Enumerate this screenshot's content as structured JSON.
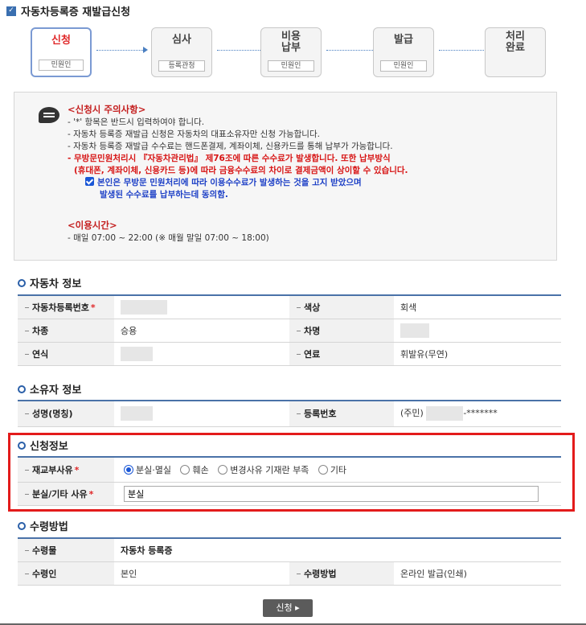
{
  "page_title": "자동차등록증 재발급신청",
  "steps": [
    {
      "name": "신청",
      "role": "민원인",
      "active": true
    },
    {
      "name": "심사",
      "role": "등록관청"
    },
    {
      "name": "비용\n납부",
      "role": "민원인"
    },
    {
      "name": "발급",
      "role": "민원인"
    },
    {
      "name": "처리\n완료",
      "role": ""
    }
  ],
  "notice": {
    "heading": "<신청시 주의사항>",
    "line1": "- '*' 항목은 반드시 입력하여야 합니다.",
    "line2": "- 자동차 등록증 재발급 신청은 자동차의 대표소유자만 신청 가능합니다.",
    "line3": "- 자동차 등록증 재발급 수수료는 핸드폰결제, 계좌이체, 신용카드를 통해 납부가 가능합니다.",
    "red1": "- 무방문민원처리시 『자동차관리법』 제76조에 따른 수수료가 발생합니다. 또한 납부방식",
    "red2": "(휴대폰, 계좌이체, 신용카드 등)에 따라 금융수수료의 차이로 결제금액이 상이할 수 있습니다.",
    "blue1": "본인은 무방문 민원처리에 따라 이용수수료가 발생하는 것을 고지 받았으며",
    "blue2": "발생된 수수료를 납부하는데 동의함.",
    "hours_heading": "<이용시간>",
    "hours": "- 매일 07:00 ~ 22:00 (※ 매월 말일 07:00 ~ 18:00)"
  },
  "vehicle": {
    "title": "자동차 정보",
    "reg_no_label": "자동차등록번호",
    "color_label": "색상",
    "color_value": "회색",
    "type_label": "차종",
    "type_value": "승용",
    "name_label": "차명",
    "year_label": "연식",
    "fuel_label": "연료",
    "fuel_value": "휘발유(무연)"
  },
  "owner": {
    "title": "소유자 정보",
    "name_label": "성명(명칭)",
    "reg_label": "등록번호",
    "reg_prefix": "(주민)",
    "reg_suffix": "-*******"
  },
  "apply": {
    "title": "신청정보",
    "reason_label": "재교부사유",
    "options": [
      "분실·멸실",
      "훼손",
      "변경사유 기재란 부족",
      "기타"
    ],
    "selected": "분실·멸실",
    "detail_label": "분실/기타 사유",
    "detail_value": "분실"
  },
  "receive": {
    "title": "수령방법",
    "item_label": "수령물",
    "item_value": "자동차 등록증",
    "person_label": "수령인",
    "person_value": "본인",
    "method_label": "수령방법",
    "method_value": "온라인 발급(인쇄)"
  },
  "submit_label": "신청 ▸",
  "required_mark": "*",
  "colors": {
    "accent": "#3a6fb0",
    "required": "#e0292a",
    "highlight": "#e31b1b"
  }
}
